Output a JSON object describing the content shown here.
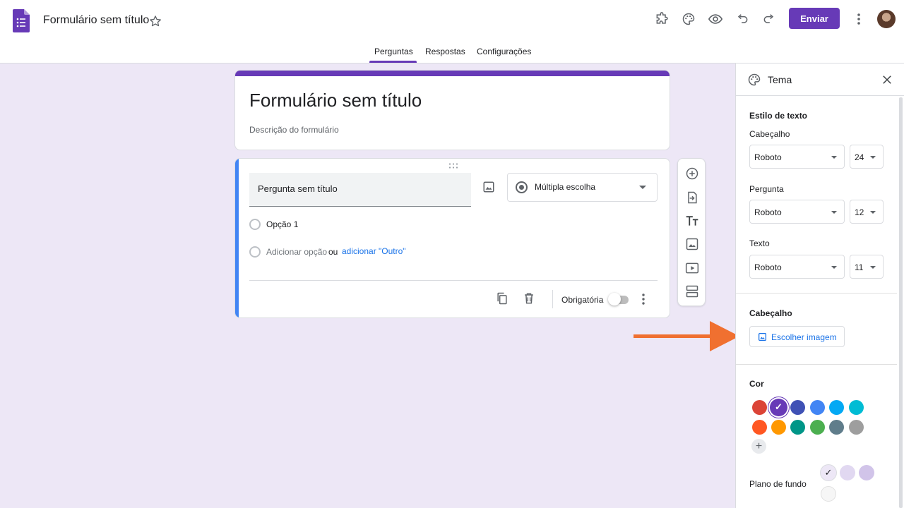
{
  "header": {
    "doc_title": "Formulário sem título",
    "send_label": "Enviar",
    "accent_color": "#673ab7"
  },
  "tabs": [
    {
      "label": "Perguntas",
      "active": true
    },
    {
      "label": "Respostas",
      "active": false
    },
    {
      "label": "Configurações",
      "active": false
    }
  ],
  "form": {
    "title": "Formulário sem título",
    "description_placeholder": "Descrição do formulário"
  },
  "question": {
    "title": "Pergunta sem título",
    "type": "Múltipla escolha",
    "options": [
      "Opção 1"
    ],
    "add_option": "Adicionar opção",
    "or_text": "ou",
    "add_other": "adicionar \"Outro\"",
    "required_label": "Obrigatória",
    "required": false
  },
  "floating_toolbar": {
    "icons": [
      "add-question-icon",
      "import-questions-icon",
      "add-title-icon",
      "add-image-icon",
      "add-video-icon",
      "add-section-icon"
    ]
  },
  "theme_panel": {
    "title": "Tema",
    "text_style_heading": "Estilo de texto",
    "header_label": "Cabeçalho",
    "header_font": "Roboto",
    "header_size": "24",
    "question_label": "Pergunta",
    "question_font": "Roboto",
    "question_size": "12",
    "text_label": "Texto",
    "text_font": "Roboto",
    "text_size": "11",
    "header_section": "Cabeçalho",
    "choose_image": "Escolher imagem",
    "color_section": "Cor",
    "colors": [
      "#db4437",
      "#673ab7",
      "#3f51b5",
      "#4285f4",
      "#03a9f4",
      "#00bcd4",
      "#ff5722",
      "#ff9800",
      "#009688",
      "#4caf50",
      "#607d8b",
      "#9e9e9e"
    ],
    "selected_color": "#673ab7",
    "background_label": "Plano de fundo",
    "backgrounds": [
      "#ede7f6",
      "#e1d8f1",
      "#d1c4e9",
      "#f6f6f6"
    ]
  }
}
